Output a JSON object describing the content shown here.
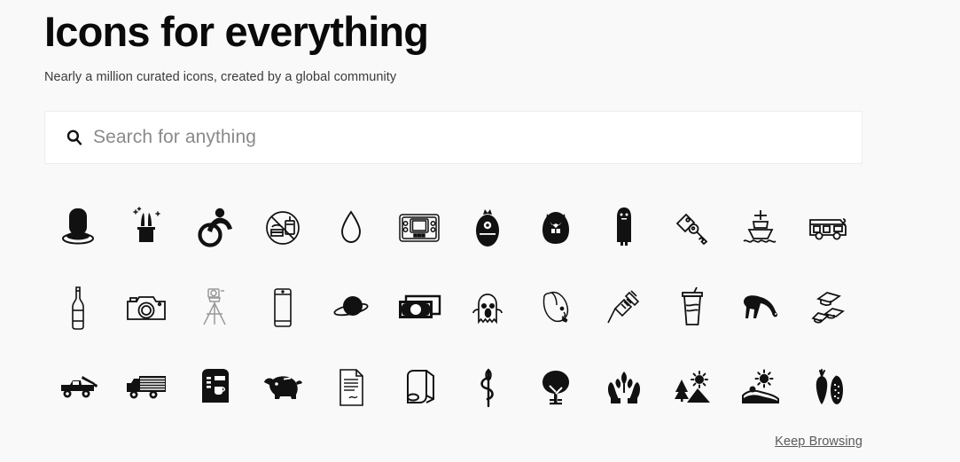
{
  "header": {
    "title": "Icons for everything",
    "subtitle": "Nearly a million curated icons, created by a global community"
  },
  "search": {
    "icon": "search-icon",
    "placeholder": "Search for anything",
    "value": ""
  },
  "footer": {
    "keep_browsing_label": "Keep Browsing"
  },
  "colors": {
    "page_background": "#f9f9f9",
    "search_background": "#ffffff",
    "search_border": "#ededed",
    "icon_color": "#111111",
    "title_color": "#0a0a0a",
    "subtitle_color": "#3b3b3b",
    "link_color": "#5a5a5a"
  },
  "icon_grid": {
    "columns": 12,
    "rows": 3,
    "icons": [
      {
        "name": "top-hat-icon",
        "style": "solid"
      },
      {
        "name": "magic-hat-rabbit-icon",
        "style": "mixed"
      },
      {
        "name": "wheelchair-accessible-icon",
        "style": "solid"
      },
      {
        "name": "no-food-or-drink-icon",
        "style": "outline"
      },
      {
        "name": "water-drop-icon",
        "style": "outline"
      },
      {
        "name": "handheld-game-console-icon",
        "style": "outline"
      },
      {
        "name": "cyclops-monster-icon",
        "style": "solid"
      },
      {
        "name": "fanged-monster-icon",
        "style": "solid"
      },
      {
        "name": "tall-monster-icon",
        "style": "solid"
      },
      {
        "name": "keys-with-tag-icon",
        "style": "outline"
      },
      {
        "name": "ship-on-water-icon",
        "style": "outline"
      },
      {
        "name": "camper-van-icon",
        "style": "outline"
      },
      {
        "name": "wine-bottle-icon",
        "style": "outline"
      },
      {
        "name": "camera-icon",
        "style": "outline"
      },
      {
        "name": "camera-tripod-icon",
        "style": "outline"
      },
      {
        "name": "smartphone-icon",
        "style": "outline"
      },
      {
        "name": "planet-saturn-icon",
        "style": "solid"
      },
      {
        "name": "banknotes-money-icon",
        "style": "solid"
      },
      {
        "name": "ghost-icon",
        "style": "outline"
      },
      {
        "name": "cat-head-icon",
        "style": "outline"
      },
      {
        "name": "syringe-icon",
        "style": "outline"
      },
      {
        "name": "soda-cup-icon",
        "style": "outline"
      },
      {
        "name": "grazing-cow-icon",
        "style": "solid"
      },
      {
        "name": "graduation-caps-icon",
        "style": "outline"
      },
      {
        "name": "tow-truck-icon",
        "style": "solid"
      },
      {
        "name": "delivery-truck-icon",
        "style": "solid"
      },
      {
        "name": "coffee-machine-icon",
        "style": "solid"
      },
      {
        "name": "piggy-bank-icon",
        "style": "solid"
      },
      {
        "name": "signed-document-icon",
        "style": "outline"
      },
      {
        "name": "fabric-roll-icon",
        "style": "outline"
      },
      {
        "name": "needle-and-thread-icon",
        "style": "solid"
      },
      {
        "name": "tree-icon",
        "style": "solid"
      },
      {
        "name": "hands-holding-plant-icon",
        "style": "solid"
      },
      {
        "name": "forest-mountain-sun-icon",
        "style": "solid"
      },
      {
        "name": "farm-field-sun-icon",
        "style": "solid"
      },
      {
        "name": "carrot-and-corn-icon",
        "style": "solid"
      }
    ]
  }
}
